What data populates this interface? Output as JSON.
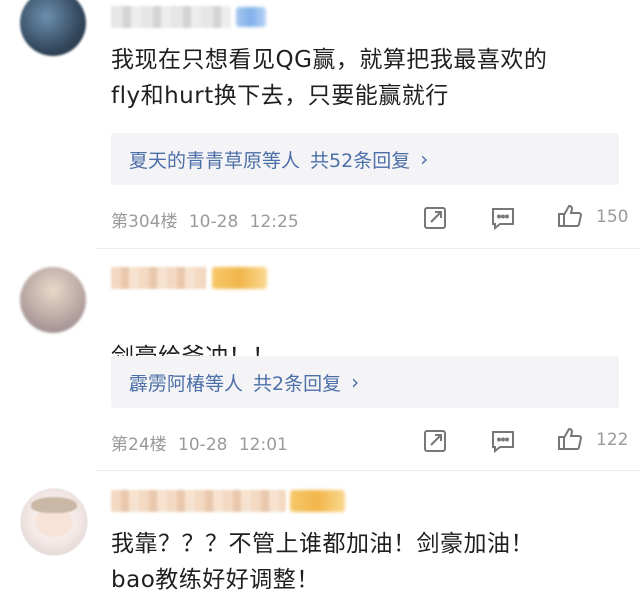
{
  "comments": [
    {
      "text": "我现在只想看见QG赢，就算把我最喜欢的\nfly和hurt换下去，只要能赢就行",
      "reply_names": "夏天的青青草原等人",
      "reply_count": "共52条回复",
      "floor": "第304楼",
      "date": "10-28",
      "time": "12:25",
      "likes": "150"
    },
    {
      "text": "剑豪给爷冲！！",
      "emoji_count": 3,
      "reply_names": "霹雳阿椿等人",
      "reply_count": "共2条回复",
      "floor": "第24楼",
      "date": "10-28",
      "time": "12:01",
      "likes": "122"
    },
    {
      "text": "我靠？？？不管上谁都加油！剑豪加油！\nbao教练好好调整！"
    }
  ],
  "icons": {
    "share": "share-icon",
    "comment": "comment-icon",
    "like": "thumbs-up-icon",
    "chevron": "chevron-right-icon"
  },
  "colors": {
    "link": "#4d6fa8",
    "meta": "#9a9a9a",
    "reply_bg": "#f4f4f6"
  }
}
